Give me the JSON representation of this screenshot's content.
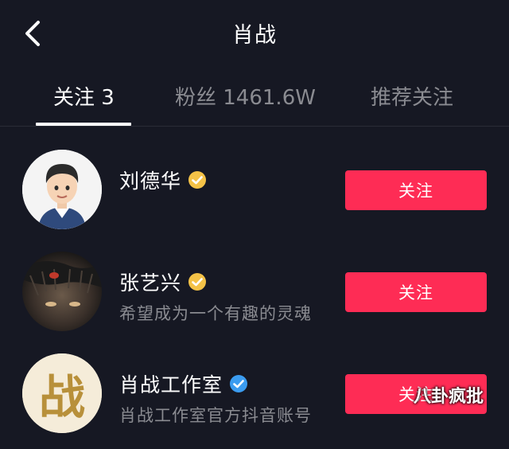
{
  "header": {
    "title": "肖战",
    "back_icon": "chevron-left-icon"
  },
  "tabs": [
    {
      "label": "关注 3",
      "active": true
    },
    {
      "label": "粉丝 1461.6W",
      "active": false
    },
    {
      "label": "推荐关注",
      "active": false
    }
  ],
  "users": [
    {
      "name": "刘德华",
      "badge": "gold-verified-icon",
      "description": "",
      "follow_label": "关注",
      "avatar": "cartoon-avatar"
    },
    {
      "name": "张艺兴",
      "badge": "gold-verified-icon",
      "description": "希望成为一个有趣的灵魂",
      "follow_label": "关注",
      "avatar": "dark-photo-avatar"
    },
    {
      "name": "肖战工作室",
      "badge": "blue-verified-icon",
      "description": "肖战工作室官方抖音账号",
      "follow_label": "关注",
      "avatar": "calligraphy-logo-avatar",
      "avatar_text": "战"
    }
  ],
  "watermark": "八卦疯批",
  "colors": {
    "background": "#161823",
    "accent": "#fe2c55",
    "gold_badge": "#f4c247",
    "blue_badge": "#3b9cf0",
    "muted_text": "#8a8b91"
  }
}
